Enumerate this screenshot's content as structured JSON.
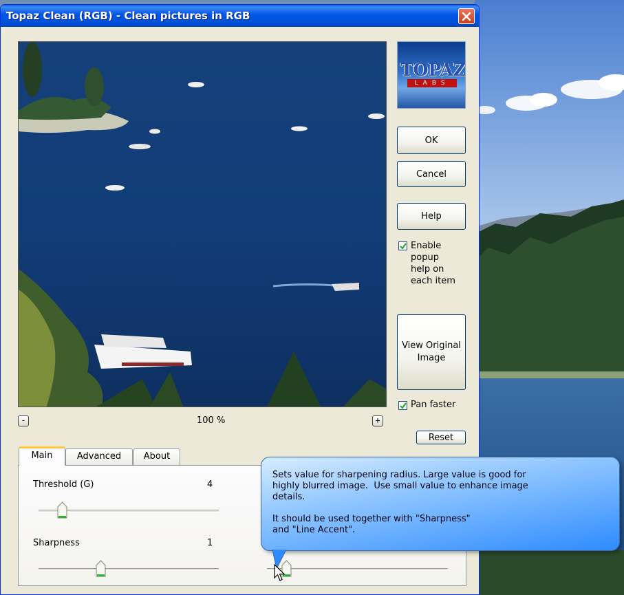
{
  "window": {
    "title": "Topaz Clean (RGB) - Clean pictures in RGB"
  },
  "logo": {
    "brand": "TOPAZ",
    "sub": "LABS"
  },
  "buttons": {
    "ok": "OK",
    "cancel": "Cancel",
    "help": "Help",
    "view_original": "View Original Image",
    "reset": "Reset"
  },
  "options": {
    "enable_popup_help": {
      "label": "Enable popup help on each item",
      "checked": true
    },
    "pan_faster": {
      "label": "Pan faster",
      "checked": true
    }
  },
  "preview": {
    "zoom_out": "-",
    "zoom_in": "+",
    "zoom_level": "100 %"
  },
  "tabs": [
    {
      "label": "Main",
      "active": true
    },
    {
      "label": "Advanced",
      "active": false
    },
    {
      "label": "About",
      "active": false
    }
  ],
  "params": {
    "threshold": {
      "label": "Threshold (G)",
      "value": "4"
    },
    "sharpness": {
      "label": "Sharpness",
      "value": "1"
    }
  },
  "tooltip": {
    "text": "Sets value for sharpening radius. Large value is good for\nhighly blurred image.  Use small value to enhance image\ndetails.\n\nIt should be used together with \"Sharpness\"\nand \"Line Accent\"."
  },
  "colors": {
    "title_bar": "#0055e5",
    "dialog_bg": "#ece9d8",
    "tooltip_bg": "#5aa8ff",
    "active_tab_accent": "#ffc83c"
  }
}
